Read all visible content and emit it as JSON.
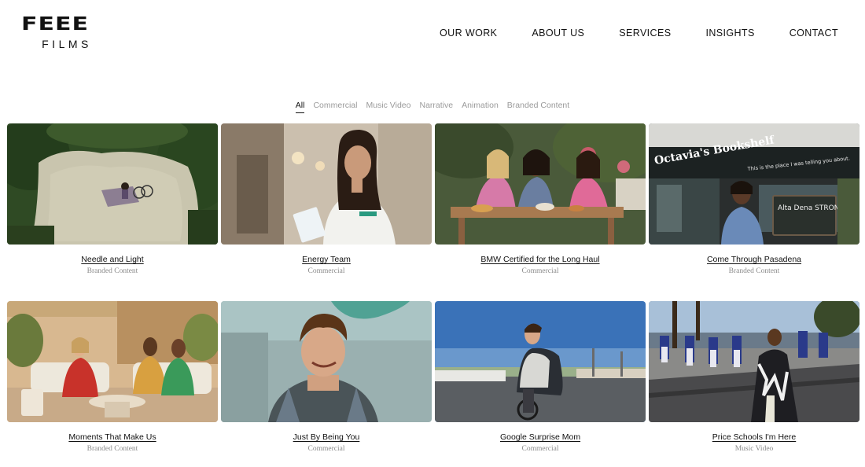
{
  "brand": {
    "mark": "FEEE",
    "sub": "FILMS"
  },
  "nav": [
    "OUR WORK",
    "ABOUT US",
    "SERVICES",
    "INSIGHTS",
    "CONTACT"
  ],
  "filters": {
    "active": "All",
    "items": [
      "All",
      "Commercial",
      "Music Video",
      "Narrative",
      "Animation",
      "Branded Content"
    ]
  },
  "projects": [
    {
      "title": "Needle and Light",
      "category": "Branded Content"
    },
    {
      "title": "Energy Team",
      "category": "Commercial"
    },
    {
      "title": "BMW Certified for the Long Haul",
      "category": "Commercial"
    },
    {
      "title": "Come Through Pasadena",
      "category": "Branded Content",
      "sign_text": "Octavia's Bookshelf",
      "sign_sub": "This is the place I was telling you about.",
      "board_text": "Alta Dena STRONG"
    },
    {
      "title": "Moments That Make Us",
      "category": "Branded Content"
    },
    {
      "title": "Just By Being You",
      "category": "Commercial"
    },
    {
      "title": "Google Surprise Mom",
      "category": "Commercial"
    },
    {
      "title": "Price Schools I'm Here",
      "category": "Music Video"
    }
  ]
}
